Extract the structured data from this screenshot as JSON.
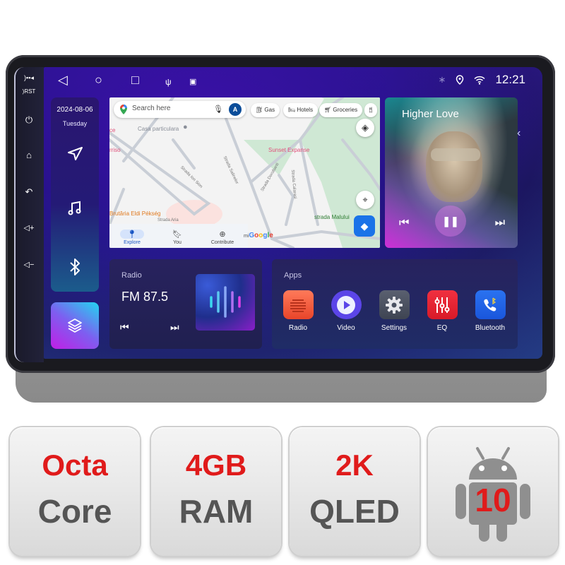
{
  "status_bar": {
    "nav_buttons": [
      "back-icon",
      "home-icon",
      "recents-icon"
    ],
    "indicators": [
      "usb-icon",
      "image-icon"
    ],
    "right_icons": [
      "bluetooth-icon",
      "location-icon",
      "wifi-icon"
    ],
    "time": "12:21"
  },
  "hardware_keys": [
    "mic-icon",
    "rst-icon",
    "power-icon",
    "home-icon",
    "back-icon",
    "volume-up-icon",
    "volume-down-icon"
  ],
  "left_panel": {
    "date": "2024-08-06",
    "weekday": "Tuesday",
    "shortcuts": [
      "navigation-icon",
      "music-icon",
      "bluetooth-icon"
    ],
    "layers_button": "layers-icon"
  },
  "map": {
    "search_placeholder": "Search here",
    "avatar_letter": "A",
    "chips": [
      {
        "label": "Gas",
        "icon": "gas-icon"
      },
      {
        "label": "Hotels",
        "icon": "hotel-icon"
      },
      {
        "label": "Groceries",
        "icon": "cart-icon"
      }
    ],
    "pois": [
      {
        "label": "Casa particulara",
        "color": "#8a8f99"
      },
      {
        "label": "Sunset Expanse",
        "color": "#e0507a"
      },
      {
        "label": "Brutăria Eldi Pékség",
        "color": "#e07a1f"
      },
      {
        "label": "strada Malului",
        "color": "#2e7d32"
      },
      {
        "label": "rriso",
        "color": "#e0507a"
      },
      {
        "label": "ce",
        "color": "#e0507a"
      }
    ],
    "streets": [
      "Strada Ion Sion",
      "Strada Salinelor",
      "Strada Dorobanti",
      "Strada Calarasi",
      "Strada Aria"
    ],
    "bottom_nav": [
      {
        "label": "Explore",
        "icon": "pin-icon",
        "active": true
      },
      {
        "label": "You",
        "icon": "bookmark-icon",
        "active": false
      },
      {
        "label": "Contribute",
        "icon": "plus-circle-icon",
        "active": false
      }
    ],
    "google_logo": "Google",
    "scale_prefix": "mi"
  },
  "music": {
    "title": "Higher Love",
    "controls": [
      "previous-icon",
      "pause-icon",
      "next-icon"
    ]
  },
  "radio": {
    "label": "Radio",
    "frequency": "FM 87.5"
  },
  "apps": {
    "label": "Apps",
    "items": [
      {
        "label": "Radio",
        "icon": "radio-icon",
        "color": "#f05a3c"
      },
      {
        "label": "Video",
        "icon": "play-icon",
        "color": "#5b45e8"
      },
      {
        "label": "Settings",
        "icon": "gear-icon",
        "color": "#4a5060"
      },
      {
        "label": "EQ",
        "icon": "equalizer-icon",
        "color": "#e8202c"
      },
      {
        "label": "Bluetooth",
        "icon": "bluetooth-phone-icon",
        "color": "#1e63e8"
      }
    ]
  },
  "features": [
    {
      "top": "Octa",
      "bottom": "Core"
    },
    {
      "top": "4GB",
      "bottom": "RAM"
    },
    {
      "top": "2K",
      "bottom": "QLED"
    },
    {
      "top": "",
      "bottom": "10",
      "icon": "android-icon"
    }
  ],
  "colors": {
    "accent_red": "#e01b1b",
    "tile_text_gray": "#555555",
    "screen_bg": "#26128a"
  }
}
